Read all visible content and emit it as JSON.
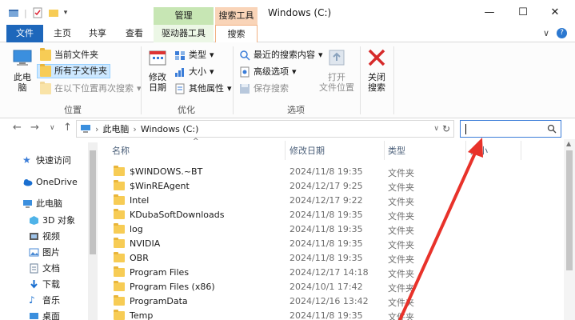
{
  "window": {
    "title": "Windows (C:)",
    "context_tabs": {
      "manage": "管理",
      "search_tools": "搜索工具"
    },
    "controls": {
      "minimize": "—",
      "maximize": "☐",
      "close": "✕"
    }
  },
  "ribbon_tabs": {
    "file": "文件",
    "home": "主页",
    "share": "共享",
    "view": "查看",
    "drive_tools": "驱动器工具",
    "search": "搜索",
    "collapse": "∨",
    "help": "?"
  },
  "ribbon": {
    "location": {
      "this_pc_label": "此电\n脑",
      "current_folder": "当前文件夹",
      "all_subfolders": "所有子文件夹",
      "search_again": "在以下位置再次搜索",
      "group_label": "位置"
    },
    "refine": {
      "modified_date": "修改\n日期",
      "kind": "类型",
      "size": "大小",
      "other_props": "其他属性",
      "group_label": "优化"
    },
    "options": {
      "recent_searches": "最近的搜索内容",
      "advanced": "高级选项",
      "save_search": "保存搜索",
      "open_location": "打开\n文件位置",
      "group_label": "选项"
    },
    "close": {
      "label": "关闭\n搜索"
    }
  },
  "address": {
    "path": [
      "此电脑",
      "Windows (C:)"
    ],
    "search_placeholder": ""
  },
  "nav_pane": {
    "items": [
      {
        "label": "快速访问",
        "icon": "star-icon"
      },
      {
        "label": "OneDrive",
        "icon": "cloud-icon"
      },
      {
        "label": "此电脑",
        "icon": "computer-icon"
      },
      {
        "label": "3D 对象",
        "icon": "cube-icon"
      },
      {
        "label": "视频",
        "icon": "video-icon"
      },
      {
        "label": "图片",
        "icon": "picture-icon"
      },
      {
        "label": "文档",
        "icon": "document-icon"
      },
      {
        "label": "下载",
        "icon": "download-icon"
      },
      {
        "label": "音乐",
        "icon": "music-icon"
      },
      {
        "label": "桌面",
        "icon": "desktop-icon"
      }
    ]
  },
  "file_list": {
    "columns": {
      "name": "名称",
      "date": "修改日期",
      "type": "类型",
      "size": "大小"
    },
    "rows": [
      {
        "name": "$WINDOWS.~BT",
        "date": "2024/11/8 19:35",
        "type": "文件夹"
      },
      {
        "name": "$WinREAgent",
        "date": "2024/12/17 9:25",
        "type": "文件夹"
      },
      {
        "name": "Intel",
        "date": "2024/12/17 9:22",
        "type": "文件夹"
      },
      {
        "name": "KDubaSoftDownloads",
        "date": "2024/11/8 19:35",
        "type": "文件夹"
      },
      {
        "name": "log",
        "date": "2024/11/8 19:35",
        "type": "文件夹"
      },
      {
        "name": "NVIDIA",
        "date": "2024/11/8 19:35",
        "type": "文件夹"
      },
      {
        "name": "OBR",
        "date": "2024/11/8 19:35",
        "type": "文件夹"
      },
      {
        "name": "Program Files",
        "date": "2024/12/17 14:18",
        "type": "文件夹"
      },
      {
        "name": "Program Files (x86)",
        "date": "2024/10/1 17:42",
        "type": "文件夹"
      },
      {
        "name": "ProgramData",
        "date": "2024/12/16 13:42",
        "type": "文件夹"
      },
      {
        "name": "Temp",
        "date": "2024/11/8 19:35",
        "type": "文件夹"
      }
    ]
  },
  "colors": {
    "accent": "#1e67bb",
    "arrow": "#e8322a",
    "folder": "#f7cc55"
  }
}
